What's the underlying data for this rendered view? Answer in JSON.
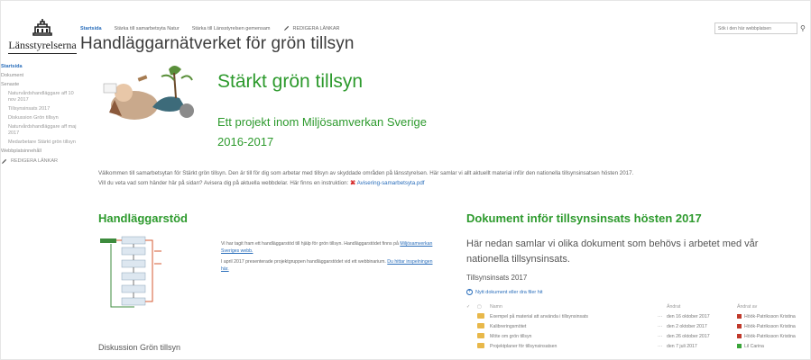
{
  "brand": {
    "name": "Länsstyrelserna"
  },
  "topnav": {
    "items": [
      "Startsida",
      "Stärka till samarbetsyta Natur",
      "Stärka till Länsstyrelsen gemensam",
      "REDIGERA LÄNKAR"
    ]
  },
  "site_title": "Handläggarnätverket för grön tillsyn",
  "search": {
    "placeholder": "Sök i den här webbplatsen"
  },
  "leftnav": {
    "items": [
      {
        "label": "Startsida",
        "level": 0
      },
      {
        "label": "Dokument",
        "level": 0
      },
      {
        "label": "Senaste",
        "level": 0
      },
      {
        "label": "Naturvårdshandläggare aff 10 nov 2017",
        "level": 1
      },
      {
        "label": "Tillsynsinsats 2017",
        "level": 1
      },
      {
        "label": "Diskussion Grön tillsyn",
        "level": 1
      },
      {
        "label": "Naturvårdshandläggare aff maj 2017",
        "level": 1
      },
      {
        "label": "Medarbetare Stärkt grön tillsyn",
        "level": 1
      },
      {
        "label": "Webbplatsinnehåll",
        "level": 0
      }
    ],
    "edit_label": "REDIGERA LÄNKAR"
  },
  "hero": {
    "title": "Stärkt grön tillsyn",
    "subtitle_line1": "Ett projekt inom Miljösamverkan Sverige",
    "subtitle_line2": "2016-2017"
  },
  "welcome": {
    "text1": "Välkommen till samarbetsytan för Stärkt grön tillsyn. Den är till för dig som arbetar med tillsyn av skyddade områden på länsstyrelsen. Här samlar vi allt aktuellt material inför den nationella tillsynsinsatsen hösten 2017.",
    "text2": "Vill du veta vad som händer här på sidan? Avisera dig på aktuella webbdelar. Här finns en instruktion:",
    "pdf_label": "Avisering-samarbetsyta.pdf"
  },
  "left_section": {
    "heading": "Handläggarstöd",
    "p1_text": "Vi har tagit fram ett handläggarstöd till hjälp för grön tillsyn. Handläggarstödet finns på",
    "p1_link": "Miljösamverkan Sveriges webb.",
    "p2_text": "I april 2017 presenterade projektgruppen handläggarstödet vid ett webbinarium.",
    "p2_link": "Du hittar inspelningen här."
  },
  "discussion": {
    "title": "Diskussion Grön tillsyn"
  },
  "right_section": {
    "heading": "Dokument inför tillsynsinsats hösten 2017",
    "intro": "Här nedan samlar vi olika dokument som behövs i arbetet med vår nationella tillsynsinsats.",
    "subheading": "Tillsynsinsats 2017",
    "new_doc": "Nytt dokument eller dra filer hit",
    "columns": {
      "name": "Namn",
      "modified": "Ändrat",
      "modified_by": "Ändrat av"
    },
    "rows": [
      {
        "name": "Exempel på material att använda i tillsynsinsats",
        "modified": "den 16 oktober 2017",
        "by": "Höök-Patriksson Kristina",
        "color": "#c0392b"
      },
      {
        "name": "Kalibreringsmötet",
        "modified": "den 2 oktober 2017",
        "by": "Höök-Patriksson Kristina",
        "color": "#c0392b"
      },
      {
        "name": "Möte om grön tillsyn",
        "modified": "den 26 oktober 2017",
        "by": "Höök-Patriksson Kristina",
        "color": "#c0392b"
      },
      {
        "name": "Projektplaner för tillsynsinsatsen",
        "modified": "den 7 juli 2017",
        "by": "Lil Carina",
        "color": "#3aa53a"
      }
    ]
  },
  "colors": {
    "accent_green": "#2d9a2d",
    "link_blue": "#2a6ebb"
  }
}
